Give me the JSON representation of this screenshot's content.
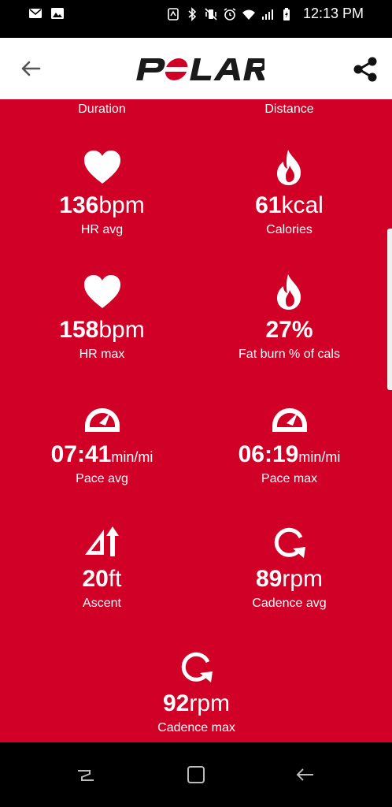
{
  "status_bar": {
    "time": "12:13 PM",
    "left_icons": [
      "mail-icon",
      "image-icon"
    ],
    "right_icons": [
      "nfc-icon",
      "bluetooth-icon",
      "vibrate-icon",
      "alarm-icon",
      "wifi-icon",
      "signal-icon",
      "battery-charging-icon"
    ]
  },
  "app_bar": {
    "back_icon": "arrow-left-icon",
    "logo_text": "POLAR",
    "share_icon": "share-icon"
  },
  "summary": {
    "top_labels": {
      "left": "Duration",
      "right": "Distance"
    },
    "metrics": [
      {
        "icon": "heart-icon",
        "value": "136",
        "unit": "bpm",
        "label": "HR avg"
      },
      {
        "icon": "flame-icon",
        "value": "61",
        "unit": "kcal",
        "label": "Calories"
      },
      {
        "icon": "heart-icon",
        "value": "158",
        "unit": "bpm",
        "label": "HR max"
      },
      {
        "icon": "flame-icon",
        "value": "27",
        "unit": "%",
        "label": "Fat burn % of cals"
      },
      {
        "icon": "speedometer-icon",
        "value": "07:41",
        "unit": "min/mi",
        "label": "Pace avg"
      },
      {
        "icon": "speedometer-icon",
        "value": "06:19",
        "unit": "min/mi",
        "label": "Pace max"
      },
      {
        "icon": "ascent-icon",
        "value": "20",
        "unit": "ft",
        "label": "Ascent"
      },
      {
        "icon": "cadence-icon",
        "value": "89",
        "unit": "rpm",
        "label": "Cadence avg"
      },
      {
        "icon": "cadence-icon",
        "value": "92",
        "unit": "rpm",
        "label": "Cadence max"
      }
    ]
  },
  "nav_bar": {
    "recents_icon": "recents-icon",
    "home_icon": "home-icon",
    "back_icon": "nav-back-icon"
  },
  "colors": {
    "background": "#d10027",
    "text": "#ffffff",
    "app_bar": "#ffffff"
  }
}
